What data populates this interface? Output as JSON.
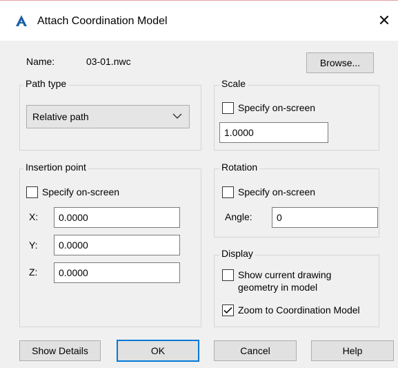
{
  "window": {
    "title": "Attach Coordination Model",
    "close_symbol": "✕"
  },
  "file": {
    "name_label": "Name:",
    "name_value": "03-01.nwc",
    "browse_label": "Browse..."
  },
  "path_type": {
    "label": "Path type",
    "selected": "Relative path"
  },
  "scale": {
    "label": "Scale",
    "specify_label": "Specify on-screen",
    "specify_checked": false,
    "value": "1.0000"
  },
  "insertion": {
    "label": "Insertion point",
    "specify_label": "Specify on-screen",
    "specify_checked": false,
    "x_label": "X:",
    "x_value": "0.0000",
    "y_label": "Y:",
    "y_value": "0.0000",
    "z_label": "Z:",
    "z_value": "0.0000"
  },
  "rotation": {
    "label": "Rotation",
    "specify_label": "Specify on-screen",
    "specify_checked": false,
    "angle_label": "Angle:",
    "angle_value": "0"
  },
  "display": {
    "label": "Display",
    "show_geometry_line1": "Show current drawing",
    "show_geometry_line2": "geometry in model",
    "show_geometry_checked": false,
    "zoom_label": "Zoom to Coordination Model",
    "zoom_checked": true
  },
  "buttons": {
    "show_details": "Show Details",
    "ok": "OK",
    "cancel": "Cancel",
    "help": "Help"
  },
  "colors": {
    "accent": "#0078d7",
    "app_icon": "#1f5fa8"
  }
}
